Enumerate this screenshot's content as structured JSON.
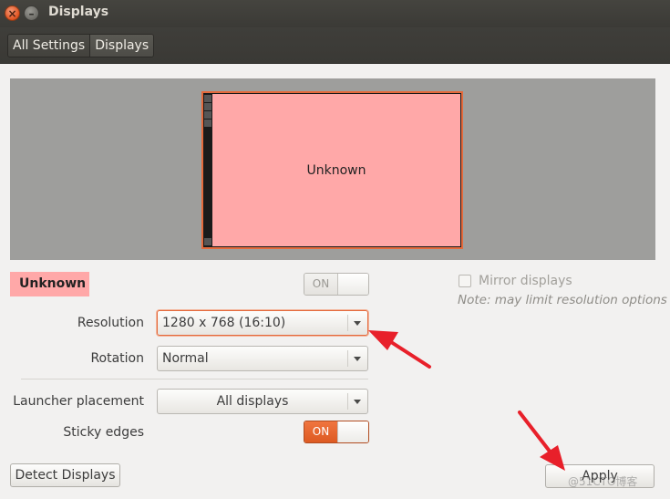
{
  "window": {
    "title": "Displays"
  },
  "toolbar": {
    "breadcrumbs": [
      "All Settings",
      "Displays"
    ]
  },
  "preview": {
    "monitor_label": "Unknown"
  },
  "display": {
    "name": "Unknown",
    "power_state": "ON"
  },
  "mirror": {
    "label": "Mirror displays",
    "checked": false,
    "note": "Note: may limit resolution options"
  },
  "resolution": {
    "label": "Resolution",
    "value": "1280 x 768 (16:10)"
  },
  "rotation": {
    "label": "Rotation",
    "value": "Normal"
  },
  "launcher": {
    "label": "Launcher placement",
    "value": "All displays"
  },
  "sticky": {
    "label": "Sticky edges",
    "state": "ON"
  },
  "buttons": {
    "detect": "Detect Displays",
    "apply": "Apply"
  },
  "colors": {
    "accent": "#dd5a22",
    "monitor_fill": "#ffa8a8",
    "annotation_arrow": "#e8202a"
  },
  "watermark": "@51CTO博客"
}
